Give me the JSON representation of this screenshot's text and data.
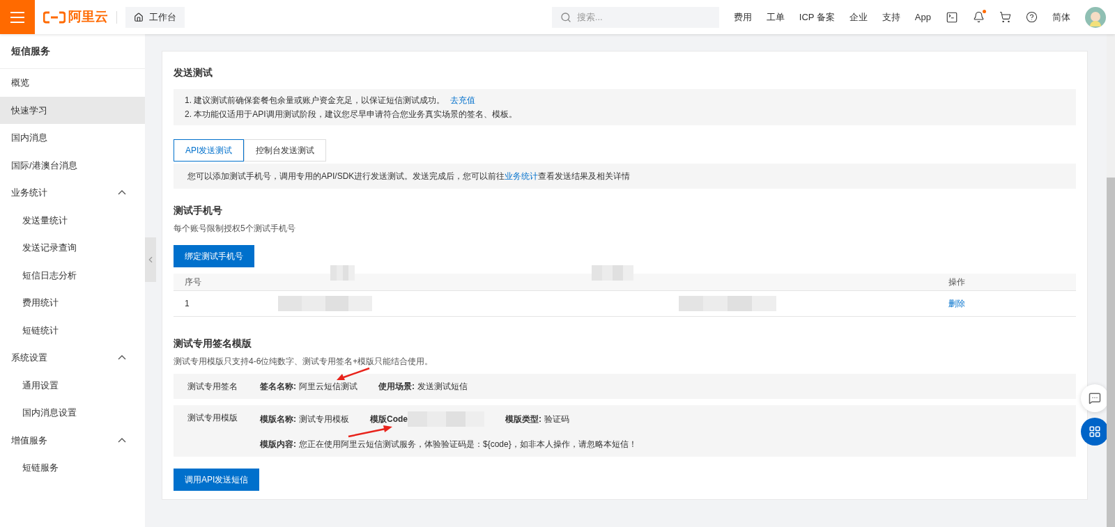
{
  "topbar": {
    "logo": "阿里云",
    "workbench": "工作台",
    "search": {
      "placeholder": "搜索..."
    },
    "nav": [
      "费用",
      "工单",
      "ICP 备案",
      "企业",
      "支持",
      "App"
    ],
    "notification_dot": true,
    "language": "简体"
  },
  "sidebar": {
    "title": "短信服务",
    "items": [
      {
        "label": "概览",
        "selected": false
      },
      {
        "label": "快速学习",
        "selected": true
      },
      {
        "label": "国内消息",
        "selected": false
      },
      {
        "label": "国际/港澳台消息",
        "selected": false
      },
      {
        "label": "业务统计",
        "selected": false,
        "expanded": true,
        "children": [
          {
            "label": "发送量统计",
            "selected": false
          },
          {
            "label": "发送记录查询",
            "selected": false
          },
          {
            "label": "短信日志分析",
            "selected": false
          },
          {
            "label": "费用统计",
            "selected": false
          },
          {
            "label": "短链统计",
            "selected": false
          }
        ]
      },
      {
        "label": "系统设置",
        "selected": false,
        "expanded": true,
        "children": [
          {
            "label": "通用设置",
            "selected": false
          },
          {
            "label": "国内消息设置",
            "selected": false
          }
        ]
      },
      {
        "label": "增值服务",
        "selected": false,
        "expanded": true,
        "children": [
          {
            "label": "短链服务",
            "selected": false
          }
        ]
      }
    ]
  },
  "card": {
    "title": "发送测试",
    "notices": [
      {
        "text": "1. 建议测试前确保套餐包余量或账户资金充足，以保证短信测试成功。",
        "link": "去充值"
      },
      {
        "text": "2. 本功能仅适用于API调用测试阶段，建议您尽早申请符合您业务真实场景的签名、模板。"
      }
    ],
    "tabs": [
      {
        "label": "API发送测试",
        "selected": true
      },
      {
        "label": "控制台发送测试",
        "selected": false
      }
    ],
    "info": {
      "before": "您可以添加测试手机号，调用专用的API/SDK进行发送测试。发送完成后，您可以前往",
      "link": "业务统计",
      "after": "查看发送结果及相关详情"
    },
    "phones": {
      "title": "测试手机号",
      "subtitle": "每个账号限制授权5个测试手机号",
      "button": "绑定测试手机号",
      "table": {
        "columns": [
          "序号",
          "操作"
        ],
        "rows": [
          {
            "index": "1",
            "action": "删除"
          }
        ]
      }
    },
    "template": {
      "title": "测试专用签名模版",
      "subtitle": "测试专用模版只支持4-6位纯数字、测试专用签名+模版只能结合使用。",
      "rows": [
        {
          "label": "测试专用签名",
          "lines": [
            [
              {
                "kind": "text",
                "name": "签名名称:",
                "value": "阿里云短信测试"
              },
              {
                "kind": "text",
                "name": "使用场景:",
                "value": "发送测试短信"
              }
            ]
          ]
        },
        {
          "label": "测试专用模版",
          "lines": [
            [
              {
                "kind": "text",
                "name": "模版名称:",
                "value": "测试专用模板"
              },
              {
                "kind": "redacted",
                "name": "模版Code"
              },
              {
                "kind": "text",
                "name": "模版类型:",
                "value": "验证码"
              }
            ],
            [
              {
                "kind": "text",
                "name": "模版内容:",
                "value": "您正在使用阿里云短信测试服务，体验验证码是：${code}，如非本人操作，请忽略本短信！"
              }
            ]
          ]
        }
      ],
      "button": "调用API发送短信"
    }
  }
}
